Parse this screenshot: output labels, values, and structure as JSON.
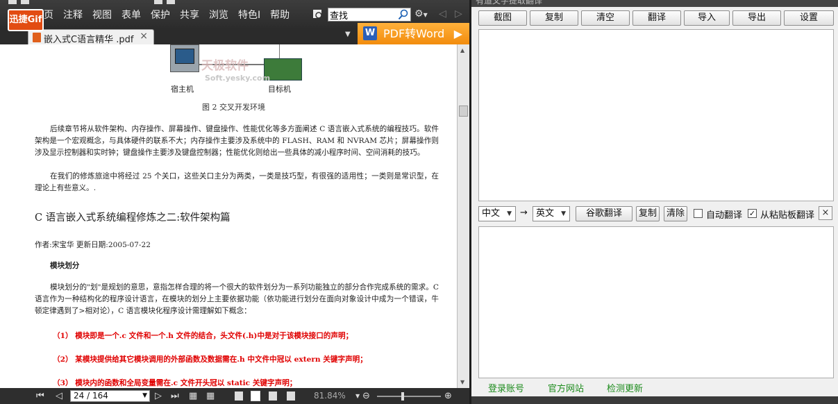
{
  "reader": {
    "gif_badge": "迅捷Gif",
    "menu": [
      "主页",
      "注释",
      "视图",
      "表单",
      "保护",
      "共享",
      "浏览",
      "特色I",
      "帮助"
    ],
    "search_value": "查找",
    "tab": {
      "label": "嵌入式C语言精华 .pdf",
      "close": "×"
    },
    "pdf2word": {
      "icon": "W",
      "label": "PDF转Word",
      "arrow": "▶"
    },
    "figure": {
      "watermark": "天极软件",
      "watermark_url": "Soft.yesky.com",
      "host_label": "宿主机",
      "target_label": "目标机",
      "caption": "图 2  交叉开发环境"
    },
    "paragraphs": [
      "后续章节将从软件架构、内存操作、屏幕操作、键盘操作、性能优化等多方面阐述 C 语言嵌入式系统的编程技巧。软件架构是一个宏观概念，与具体硬件的联系不大；内存操作主要涉及系统中的 FLASH、RAM 和 NVRAM 芯片；屏幕操作则涉及显示控制器和实时钟；键盘操作主要涉及键盘控制器；性能优化则给出一些具体的减小程序时间、空间消耗的技巧。",
      "在我们的修炼旅途中将经过 25 个关口，这些关口主分为两类，一类是技巧型，有很强的适用性；一类则是常识型，在理论上有些意义。.",
      "模块划分的\"划\"是规划的意思，意指怎样合理的将一个很大的软件划分为一系列功能独立的部分合作完成系统的需求。C 语言作为一种结构化的程序设计语言，在模块的划分上主要依据功能（依功能进行划分在面向对象设计中成为一个错误，牛顿定律遇到了>相对论），C 语言模块化程序设计需理解如下概念："
    ],
    "section_title": "C 语言嵌入式系统编程修炼之二:软件架构篇",
    "author_line": "作者:宋宝华      更新日期:2005-07-22",
    "module_heading": "模块划分",
    "red_items": [
      "（1）  模块即是一个.c 文件和一个.h 文件的结合，头文件(.h)中是对于该模块接口的声明；",
      "（2）  某模块提供给其它模块调用的外部函数及数据需在.h 中文件中冠以 extern 关键字声明；",
      "（3）  模块内的函数和全局变量需在.c 文件开头冠以 static 关键字声明；"
    ],
    "status": {
      "page_indicator": "24 / 164",
      "zoom": "81.84%"
    }
  },
  "translator": {
    "title": "有道文字提取翻译",
    "toolbar": [
      "截图",
      "复制",
      "清空",
      "翻译",
      "导入",
      "导出",
      "设置"
    ],
    "source_lang": "中文",
    "target_lang": "英文",
    "arrow": "→",
    "google_translate": "谷歌翻译",
    "copy": "复制",
    "clear": "清除",
    "auto_translate": {
      "label": "自动翻译",
      "checked": false
    },
    "clipboard_translate": {
      "label": "从粘贴板翻译",
      "checked": true
    },
    "close": "×",
    "footer": [
      "登录账号",
      "官方网站",
      "检测更新"
    ]
  },
  "colors": {
    "accent_orange": "#f28c0d",
    "red_text": "#e00000",
    "footer_green": "#1e8c1e"
  }
}
